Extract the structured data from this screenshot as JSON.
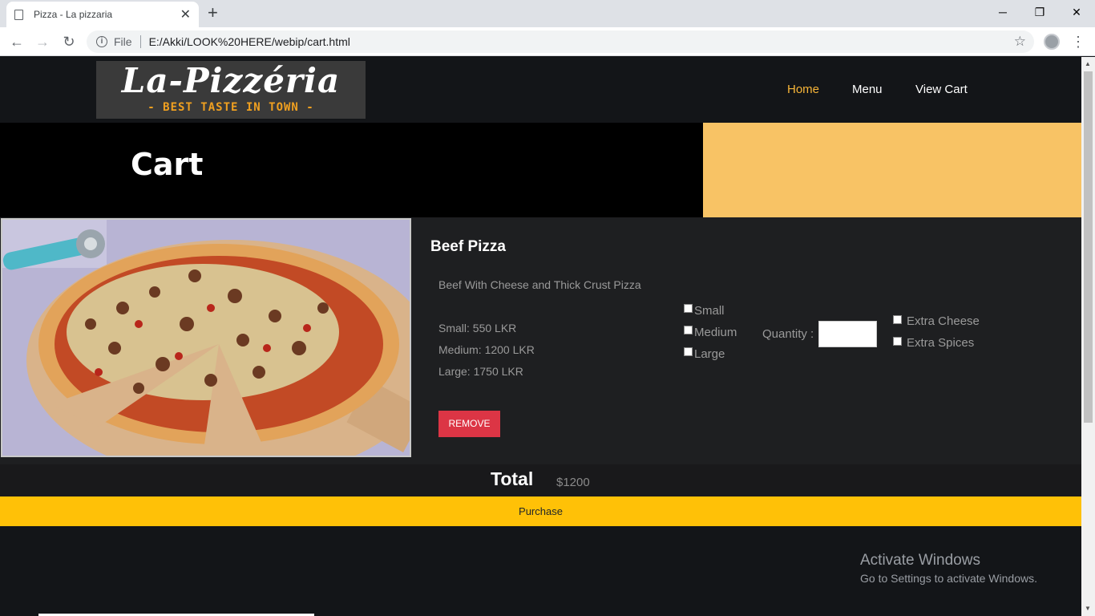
{
  "browser": {
    "tab_title": "Pizza - La pizzaria",
    "tab_close": "✕",
    "new_tab": "+",
    "minimize": "─",
    "restore": "❐",
    "close": "✕",
    "back": "←",
    "forward": "→",
    "reload": "↻",
    "info": "i",
    "file_label": "File",
    "url": "E:/Akki/LOOK%20HERE/webip/cart.html",
    "star": "☆",
    "menu": "⋮"
  },
  "site": {
    "logo_name": "La-Pizzéria",
    "logo_tagline": "- BEST TASTE IN TOWN -",
    "nav": [
      {
        "label": "Home",
        "active": true
      },
      {
        "label": "Menu",
        "active": false
      },
      {
        "label": "View Cart",
        "active": false
      }
    ],
    "accent": "#f7b538"
  },
  "hero": {
    "title": "Cart"
  },
  "cart_item": {
    "name": "Beef Pizza",
    "description": "Beef With Cheese and Thick Crust Pizza",
    "prices": [
      "Small: 550 LKR",
      "Medium: 1200 LKR",
      "Large: 1750 LKR"
    ],
    "sizes": [
      "Small",
      "Medium",
      "Large"
    ],
    "quantity_label": "Quantity :",
    "quantity_value": "",
    "extras": [
      "Extra Cheese",
      "Extra Spices"
    ],
    "remove_label": "REMOVE",
    "remove_color": "#dc3545"
  },
  "totals": {
    "label": "Total",
    "value": "$1200",
    "purchase_label": "Purchase",
    "purchase_color": "#ffc107"
  },
  "watermark": {
    "line1": "Activate Windows",
    "line2": "Go to Settings to activate Windows."
  },
  "scrollbar": {
    "up": "▲",
    "down": "▼"
  }
}
